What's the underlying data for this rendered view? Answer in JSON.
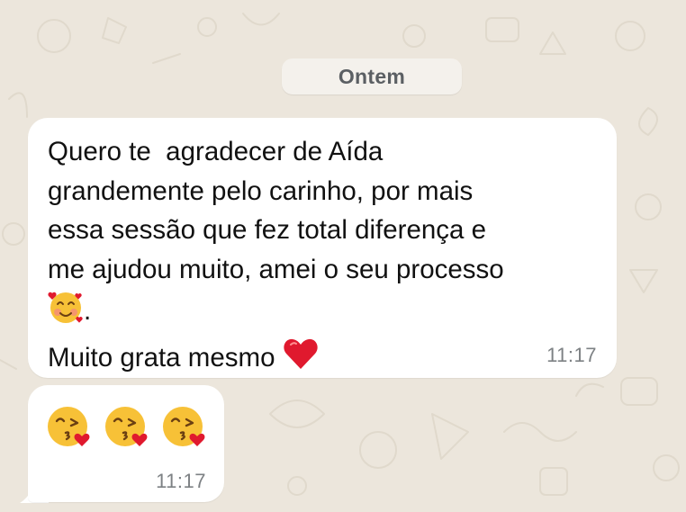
{
  "date_separator": {
    "label": "Ontem"
  },
  "messages": [
    {
      "lines": [
        "Quero te  agradecer de Aída",
        "grandemente pelo carinho, por mais",
        "essa sessão que fez total diferença e",
        "me ajudou muito, amei o seu processo",
        ".",
        "Muito grata mesmo"
      ],
      "emojis": [
        "smiling-face-with-hearts-icon",
        "red-heart-icon"
      ],
      "time": "11:17"
    },
    {
      "emojis": [
        "face-blowing-a-kiss-icon",
        "face-blowing-a-kiss-icon",
        "face-blowing-a-kiss-icon"
      ],
      "time": "11:17"
    }
  ],
  "colors": {
    "wallpaper": "#ece6dc",
    "bubble": "#ffffff",
    "text": "#111111",
    "timestamp": "#7d8184",
    "heart": "#e0192e",
    "emoji_face": "#f7c137"
  }
}
